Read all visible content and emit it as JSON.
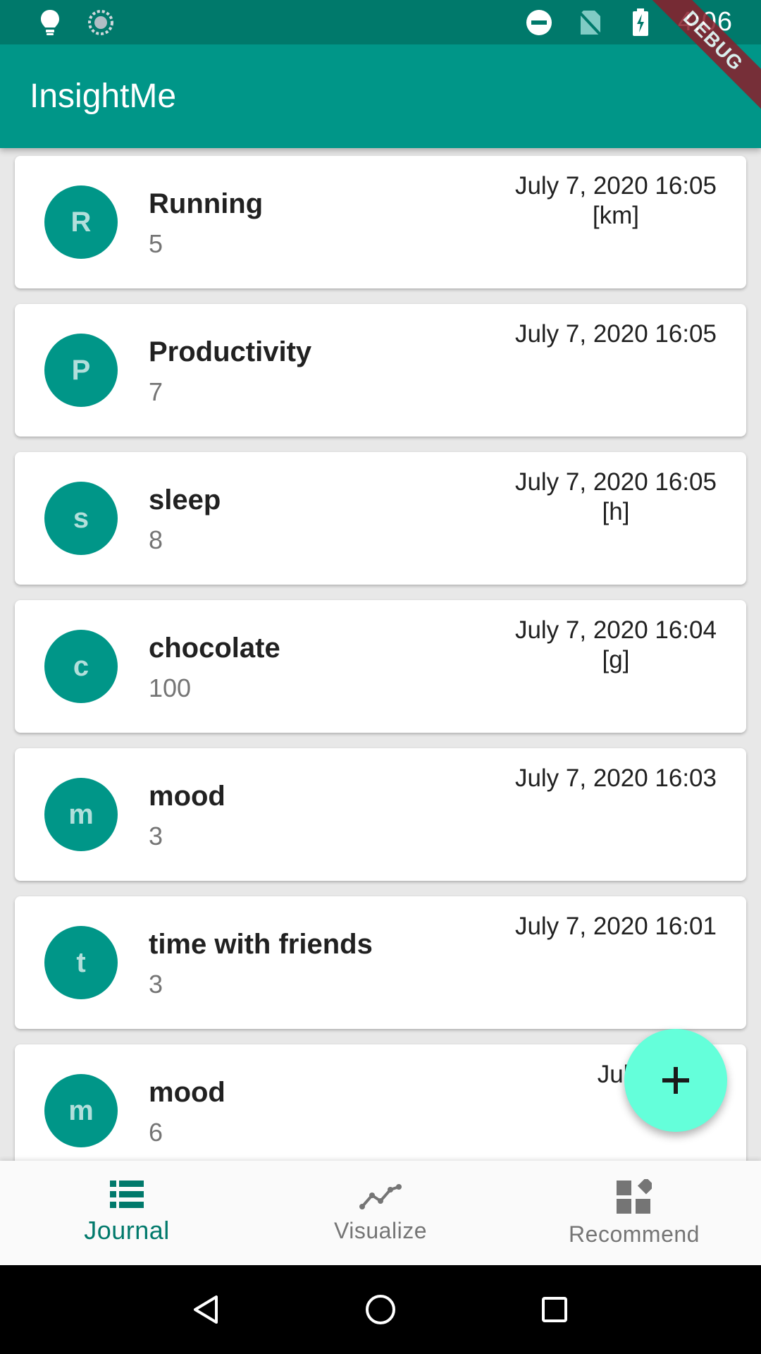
{
  "status_bar": {
    "time": "4:06",
    "icons": [
      "lightbulb-icon",
      "sync-icon",
      "do-not-disturb-icon",
      "no-sim-icon",
      "battery-charging-icon"
    ]
  },
  "app_bar": {
    "title": "InsightMe"
  },
  "debug_banner": {
    "label": "DEBUG"
  },
  "entries": [
    {
      "initial": "R",
      "name": "Running",
      "value": "5",
      "datetime": "July 7, 2020 16:05",
      "unit": "[km]"
    },
    {
      "initial": "P",
      "name": "Productivity",
      "value": "7",
      "datetime": "July 7, 2020 16:05",
      "unit": ""
    },
    {
      "initial": "s",
      "name": "sleep",
      "value": "8",
      "datetime": "July 7, 2020 16:05",
      "unit": "[h]"
    },
    {
      "initial": "c",
      "name": "chocolate",
      "value": "100",
      "datetime": "July 7, 2020 16:04",
      "unit": "[g]"
    },
    {
      "initial": "m",
      "name": "mood",
      "value": "3",
      "datetime": "July 7, 2020 16:03",
      "unit": ""
    },
    {
      "initial": "t",
      "name": "time with friends",
      "value": "3",
      "datetime": "July 7, 2020 16:01",
      "unit": ""
    },
    {
      "initial": "m",
      "name": "mood",
      "value": "6",
      "datetime": "July 6, 202",
      "unit": ""
    }
  ],
  "fab": {
    "icon": "plus-icon"
  },
  "bottom_nav": {
    "items": [
      {
        "label": "Journal",
        "icon": "list-icon",
        "active": true
      },
      {
        "label": "Visualize",
        "icon": "line-chart-icon",
        "active": false
      },
      {
        "label": "Recommend",
        "icon": "widgets-icon",
        "active": false
      }
    ]
  },
  "colors": {
    "status_bar": "#00796b",
    "app_bar": "#009688",
    "accent": "#64ffda",
    "active_nav": "#00796b"
  }
}
